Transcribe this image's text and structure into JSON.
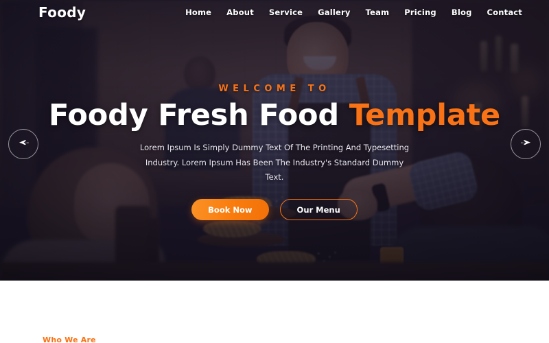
{
  "brand": {
    "name": "Foody"
  },
  "nav": {
    "items": [
      {
        "label": "Home"
      },
      {
        "label": "About"
      },
      {
        "label": "Service"
      },
      {
        "label": "Gallery"
      },
      {
        "label": "Team"
      },
      {
        "label": "Pricing"
      },
      {
        "label": "Blog"
      },
      {
        "label": "Contact"
      }
    ]
  },
  "hero": {
    "eyebrow": "WELCOME TO",
    "headline_white": "Foody Fresh Food ",
    "headline_accent": "Template",
    "lead": "Lorem Ipsum Is Simply Dummy Text Of The Printing And Typesetting Industry. Lorem Ipsum Has Been The Industry's Standard Dummy Text.",
    "primary_cta": "Book Now",
    "secondary_cta": "Our Menu",
    "prev_label": "Previous slide",
    "next_label": "Next slide"
  },
  "about": {
    "subtitle": "Who We Are"
  },
  "colors": {
    "accent": "#f97316",
    "overlay": "#2a2236",
    "text_light": "#ffffff",
    "page_bg": "#ffffff"
  }
}
